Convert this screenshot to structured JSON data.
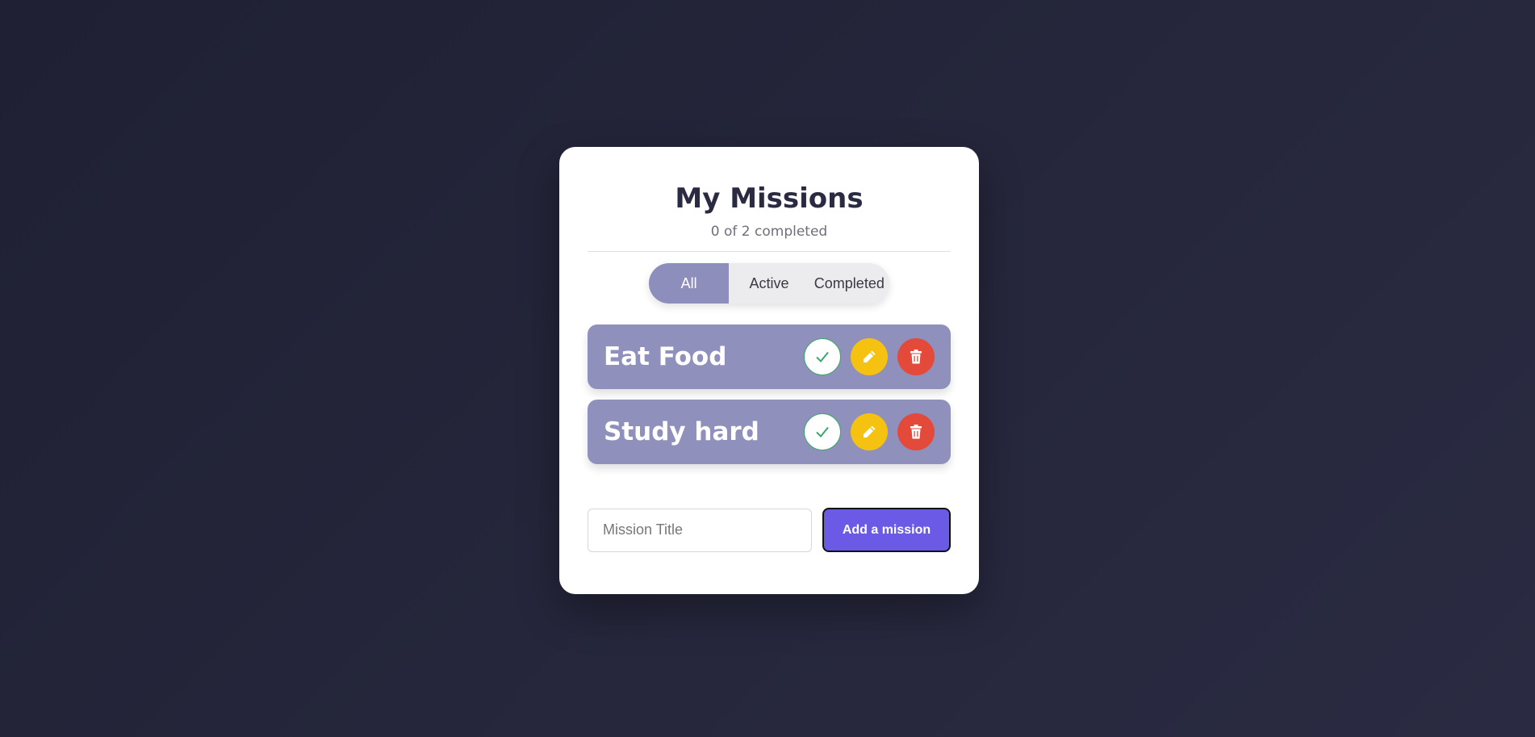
{
  "header": {
    "title": "My Missions",
    "progress_text": "0 of 2 completed"
  },
  "filters": [
    {
      "label": "All",
      "active": true
    },
    {
      "label": "Active",
      "active": false
    },
    {
      "label": "Completed",
      "active": false
    }
  ],
  "missions": [
    {
      "title": "Eat Food",
      "completed": false
    },
    {
      "title": "Study hard",
      "completed": false
    }
  ],
  "add_form": {
    "input_placeholder": "Mission Title",
    "input_value": "",
    "button_label": "Add a mission"
  },
  "icons": {
    "complete": "check-icon",
    "edit": "pencil-icon",
    "delete": "trash-icon"
  },
  "colors": {
    "accent": "#6a5ae6",
    "mission_bg": "#9090bd",
    "filter_active": "#8e8ebc",
    "complete": "#3aa86b",
    "edit": "#f5c211",
    "delete": "#e34a3a"
  }
}
